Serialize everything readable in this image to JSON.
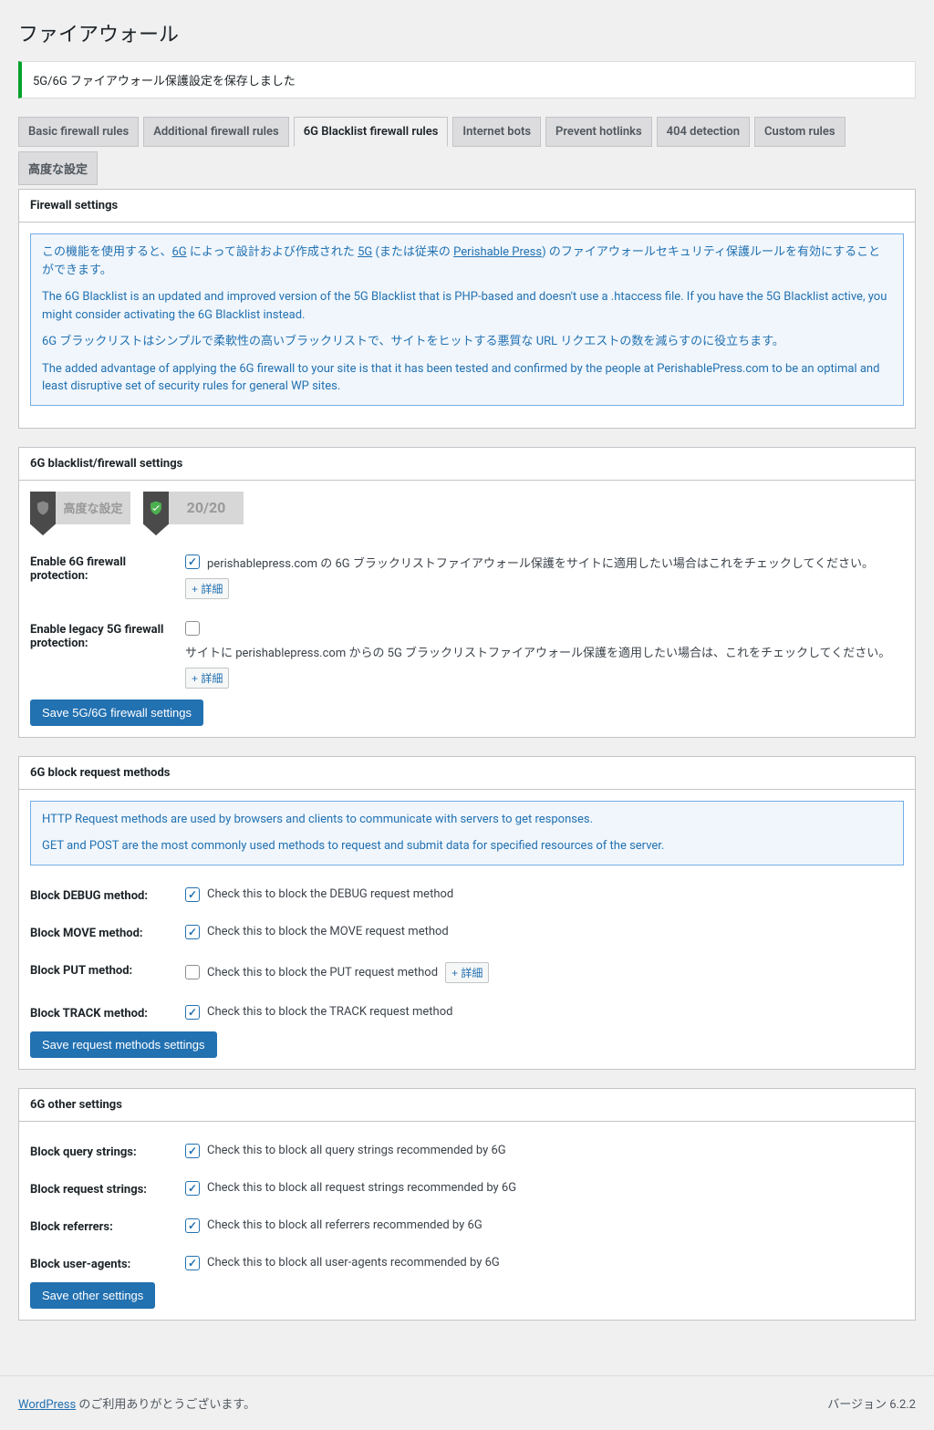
{
  "page_title": "ファイアウォール",
  "notice": "5G/6G ファイアウォール保護設定を保存しました",
  "tabs": [
    {
      "label": "Basic firewall rules",
      "active": false
    },
    {
      "label": "Additional firewall rules",
      "active": false
    },
    {
      "label": "6G Blacklist firewall rules",
      "active": true
    },
    {
      "label": "Internet bots",
      "active": false
    },
    {
      "label": "Prevent hotlinks",
      "active": false
    },
    {
      "label": "404 detection",
      "active": false
    },
    {
      "label": "Custom rules",
      "active": false
    },
    {
      "label": "高度な設定",
      "active": false
    }
  ],
  "panel1": {
    "title": "Firewall settings",
    "info_p1_a": "この機能を使用すると、",
    "info_link_6g": "6G",
    "info_p1_b": " によって設計および作成された ",
    "info_link_5g": "5G",
    "info_p1_c": " (または従来の ",
    "info_link_pp": "Perishable Press",
    "info_p1_d": ") のファイアウォールセキュリティ保護ルールを有効にすることができます。",
    "info_p2": "The 6G Blacklist is an updated and improved version of the 5G Blacklist that is PHP-based and doesn't use a .htaccess file. If you have the 5G Blacklist active, you might consider activating the 6G Blacklist instead.",
    "info_p3": "6G ブラックリストはシンプルで柔軟性の高いブラックリストで、サイトをヒットする悪質な URL リクエストの数を減らすのに役立ちます。",
    "info_p4": "The added advantage of applying the 6G firewall to your site is that it has been tested and confirmed by the people at PerishablePress.com to be an optimal and least disruptive set of security rules for general WP sites."
  },
  "panel2": {
    "title": "6G blacklist/firewall settings",
    "badge1_text": "高度な設定",
    "badge2_text": "20/20",
    "row1_label": "Enable 6G firewall protection:",
    "row1_desc": "perishablepress.com の 6G ブラックリストファイアウォール保護をサイトに適用したい場合はこれをチェックしてください。",
    "row2_label": "Enable legacy 5G firewall protection:",
    "row2_desc": "サイトに perishablepress.com からの 5G ブラックリストファイアウォール保護を適用したい場合は、これをチェックしてください。",
    "more_btn": "+ 詳細",
    "save_btn": "Save 5G/6G firewall settings"
  },
  "panel3": {
    "title": "6G block request methods",
    "info_p1": "HTTP Request methods are used by browsers and clients to communicate with servers to get responses.",
    "info_p2": "GET and POST are the most commonly used methods to request and submit data for specified resources of the server.",
    "rows": [
      {
        "label": "Block DEBUG method:",
        "desc": "Check this to block the DEBUG request method",
        "checked": true,
        "more": false
      },
      {
        "label": "Block MOVE method:",
        "desc": "Check this to block the MOVE request method",
        "checked": true,
        "more": false
      },
      {
        "label": "Block PUT method:",
        "desc": "Check this to block the PUT request method",
        "checked": false,
        "more": true
      },
      {
        "label": "Block TRACK method:",
        "desc": "Check this to block the TRACK request method",
        "checked": true,
        "more": false
      }
    ],
    "save_btn": "Save request methods settings"
  },
  "panel4": {
    "title": "6G other settings",
    "rows": [
      {
        "label": "Block query strings:",
        "desc": "Check this to block all query strings recommended by 6G",
        "checked": true
      },
      {
        "label": "Block request strings:",
        "desc": "Check this to block all request strings recommended by 6G",
        "checked": true
      },
      {
        "label": "Block referrers:",
        "desc": "Check this to block all referrers recommended by 6G",
        "checked": true
      },
      {
        "label": "Block user-agents:",
        "desc": "Check this to block all user-agents recommended by 6G",
        "checked": true
      }
    ],
    "save_btn": "Save other settings"
  },
  "footer": {
    "wp_link": "WordPress",
    "thanks": " のご利用ありがとうございます。",
    "version": "バージョン 6.2.2"
  }
}
